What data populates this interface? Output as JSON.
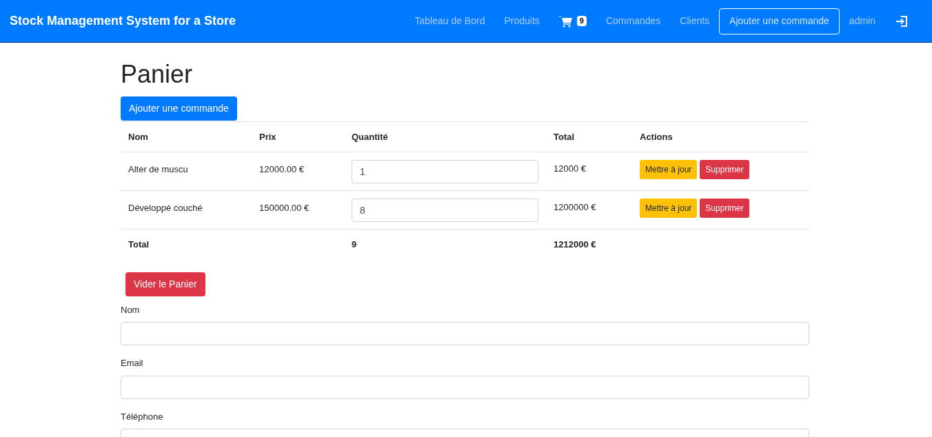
{
  "navbar": {
    "brand": "Stock Management System for a Store",
    "links": [
      {
        "kind": "link",
        "label": "Tableau de Bord"
      },
      {
        "kind": "link",
        "label": "Produits"
      },
      {
        "kind": "cart",
        "badge": "9"
      },
      {
        "kind": "link",
        "label": "Commandes"
      },
      {
        "kind": "link",
        "label": "Clients"
      },
      {
        "kind": "outline",
        "label": "Ajouter une commande"
      },
      {
        "kind": "link",
        "label": "admin"
      },
      {
        "kind": "logout"
      }
    ]
  },
  "page": {
    "title": "Panier",
    "add_button": "Ajouter une commande"
  },
  "table": {
    "columns": [
      "Nom",
      "Prix",
      "Quantité",
      "Total",
      "Actions"
    ],
    "rows": [
      {
        "name": "Alter de muscu",
        "price": "12000.00 €",
        "quantity": "1",
        "total": "12000 €",
        "actions": [
          "Mettre à jour",
          "Supprimer"
        ]
      },
      {
        "name": "Développé couché",
        "price": "150000.00 €",
        "quantity": "8",
        "total": "1200000 €",
        "actions": [
          "Mettre à jour",
          "Supprimer"
        ]
      }
    ],
    "footer": {
      "label": "Total",
      "quantity": "9",
      "total": "1212000 €"
    }
  },
  "clear_button": "Vider le Panier",
  "form": {
    "fields": [
      {
        "label": "Nom"
      },
      {
        "label": "Email"
      },
      {
        "label": "Téléphone"
      }
    ]
  }
}
